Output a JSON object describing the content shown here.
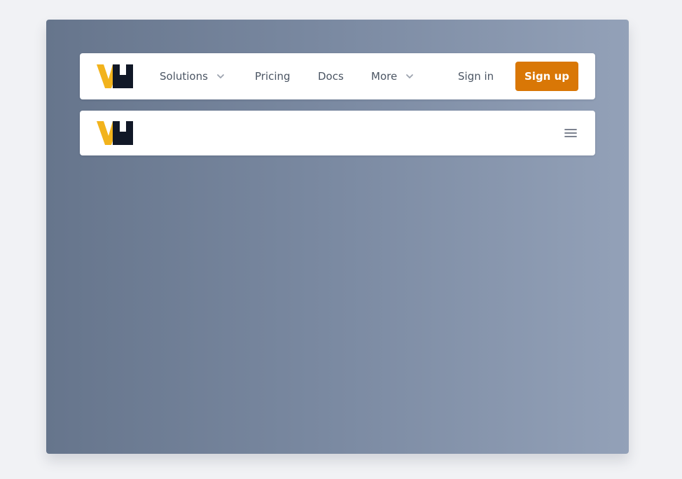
{
  "nav": {
    "items": [
      {
        "label": "Solutions",
        "icon": "chevron-down-icon"
      },
      {
        "label": "Pricing"
      },
      {
        "label": "Docs"
      },
      {
        "label": "More",
        "icon": "chevron-down-icon"
      }
    ],
    "sign_in_label": "Sign in",
    "sign_up_label": "Sign up"
  },
  "mobile_nav": {
    "menu_icon": "hamburger-menu-icon"
  },
  "colors": {
    "accent": "#d97706",
    "logo_yellow": "#f2b31c",
    "logo_dark": "#111827",
    "gradient_left": "#66758c",
    "gradient_right": "#93a1b8"
  }
}
